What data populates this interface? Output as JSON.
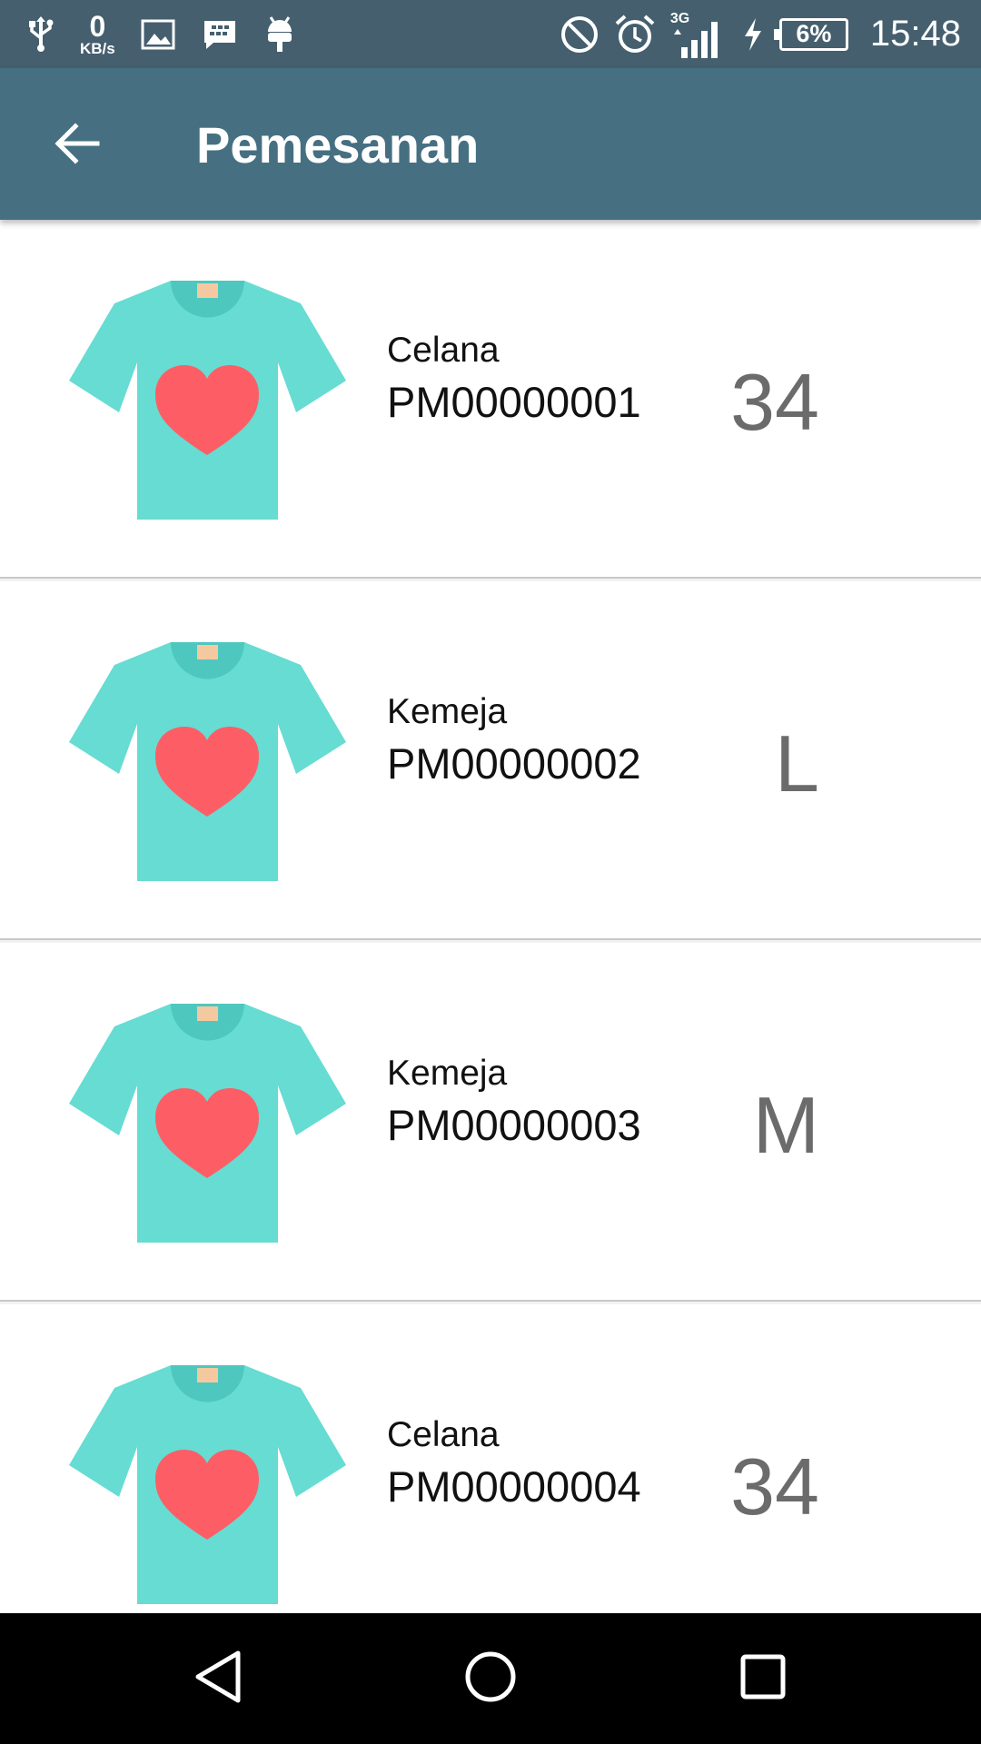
{
  "status_bar": {
    "icons_left": [
      "usb-icon",
      "image-icon",
      "bbm-icon",
      "android-icon"
    ],
    "net_speed_value": "0",
    "net_speed_unit": "KB/s",
    "icons_right": [
      "do-not-disturb-icon",
      "alarm-icon",
      "signal-3g-icon",
      "charging-icon",
      "battery-icon"
    ],
    "network_type": "3G",
    "battery_percent": "6%",
    "time": "15:48"
  },
  "app_bar": {
    "back_icon": "arrow-left-icon",
    "title": "Pemesanan"
  },
  "orders": [
    {
      "name": "Celana",
      "code": "PM00000001",
      "size": "34"
    },
    {
      "name": "Kemeja",
      "code": "PM00000002",
      "size": "L"
    },
    {
      "name": "Kemeja",
      "code": "PM00000003",
      "size": "M"
    },
    {
      "name": "Celana",
      "code": "PM00000004",
      "size": "34"
    }
  ],
  "nav_bar": {
    "buttons": [
      "back-triangle-icon",
      "home-circle-icon",
      "recents-square-icon"
    ]
  },
  "colors": {
    "status_bar": "#455f6e",
    "app_bar": "#467082",
    "shirt": "#66dcd3",
    "shirt_collar": "#4ec7bf",
    "heart": "#fd5e66",
    "tag": "#f5c9a0",
    "size_text": "#6b6b6b"
  }
}
